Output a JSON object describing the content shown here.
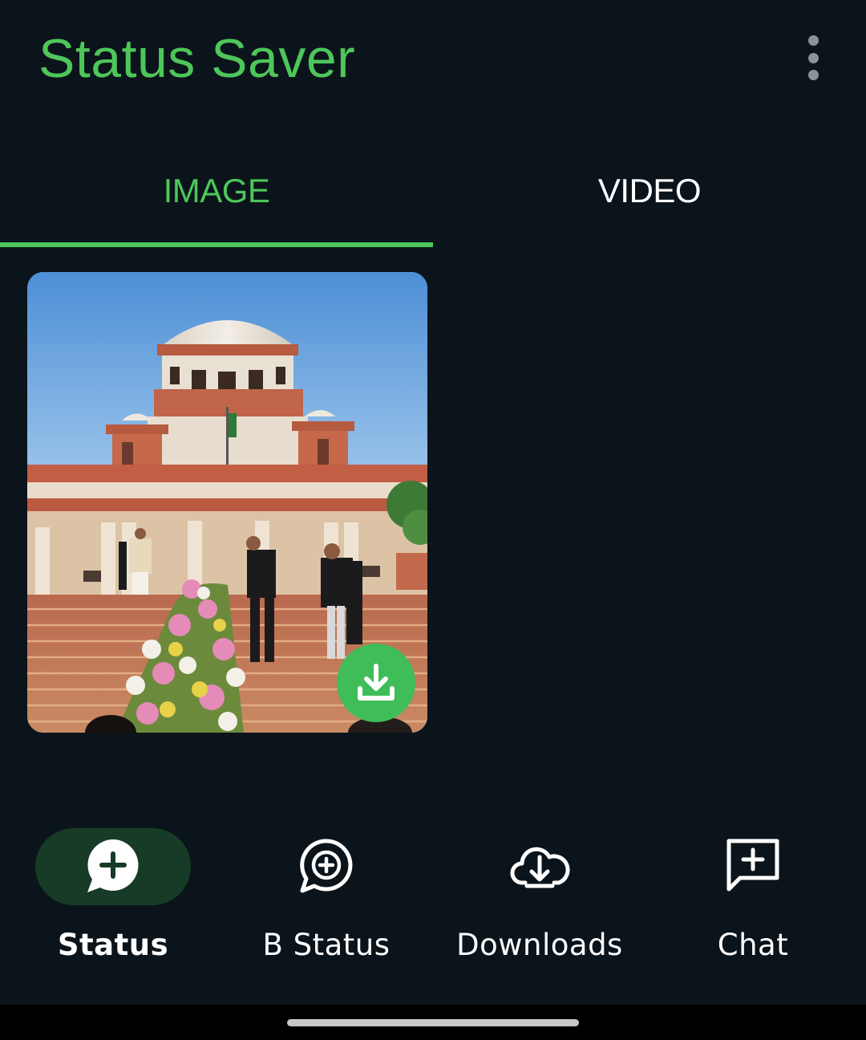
{
  "header": {
    "title": "Status Saver",
    "menu_icon": "more-vert-icon"
  },
  "tabs": [
    {
      "label": "IMAGE",
      "selected": true
    },
    {
      "label": "VIDEO",
      "selected": false
    }
  ],
  "grid": {
    "items": [
      {
        "type": "image",
        "subject": "photo",
        "action_icon": "download-icon"
      }
    ]
  },
  "bottom_nav": [
    {
      "label": "Status",
      "icon": "status-add-icon",
      "active": true
    },
    {
      "label": "B Status",
      "icon": "business-status-add-icon",
      "active": false
    },
    {
      "label": "Downloads",
      "icon": "cloud-download-icon",
      "active": false
    },
    {
      "label": "Chat",
      "icon": "chat-add-icon",
      "active": false
    }
  ],
  "colors": {
    "background": "#0b141b",
    "accent": "#4ec65a",
    "active_pill": "#173b27",
    "download_button": "#3fbd59"
  }
}
